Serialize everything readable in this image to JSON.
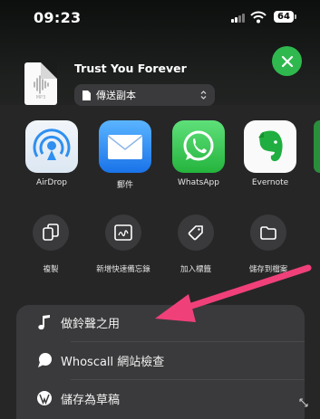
{
  "status_bar": {
    "time": "09:23",
    "battery": "64"
  },
  "file": {
    "title": "Trust You Forever",
    "ext": "MP3"
  },
  "send_copy": {
    "label": "傳送副本"
  },
  "apps": [
    {
      "name": "AirDrop",
      "icon": "airdrop-icon"
    },
    {
      "name": "郵件",
      "icon": "mail-icon"
    },
    {
      "name": "WhatsApp",
      "icon": "whatsapp-icon"
    },
    {
      "name": "Evernote",
      "icon": "evernote-icon"
    }
  ],
  "actions": [
    {
      "label": "複製",
      "icon": "copy-icon"
    },
    {
      "label": "新增快速備忘錄",
      "icon": "quick-note-icon"
    },
    {
      "label": "加入標籤",
      "icon": "tag-icon"
    },
    {
      "label": "儲存到檔案",
      "icon": "folder-icon"
    }
  ],
  "menu": [
    {
      "label": "做鈴聲之用",
      "icon": "music-note-icon"
    },
    {
      "label": "Whoscall 網站檢查",
      "icon": "whoscall-icon"
    },
    {
      "label": "儲存為草稿",
      "icon": "wordpress-icon"
    }
  ],
  "colors": {
    "accent_green": "#2fb84e",
    "annotation_arrow": "#f0407a",
    "sheet_bg": "#262627",
    "menu_bg": "#3a3a3c"
  }
}
